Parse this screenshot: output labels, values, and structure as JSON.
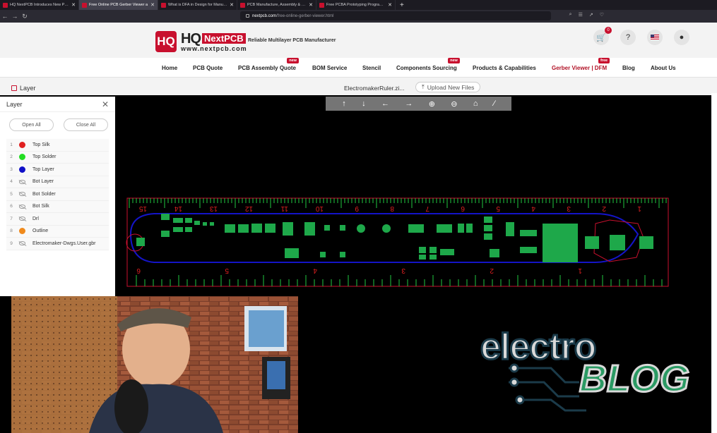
{
  "browser": {
    "tabs": [
      {
        "title": "HQ NextPCB Introduces New PCB Ger",
        "active": false
      },
      {
        "title": "Free Online PCB Gerber Viewer a",
        "active": true
      },
      {
        "title": "What is DFA in Design for Manufactur",
        "active": false
      },
      {
        "title": "PCB Manufacture, Assembly & Protot",
        "active": false
      },
      {
        "title": "Free PCBA Prototyping Program for 1",
        "active": false
      }
    ],
    "new_tab": "+",
    "url_domain": "nextpcb.com",
    "url_path": "/free-online-gerber-viewer.html"
  },
  "site": {
    "logo_mark": "HQ",
    "logo_hq": "HQ",
    "logo_brand": "NextPCB",
    "logo_www": "www.nextpcb.com",
    "tagline": "Reliable Multilayer PCB Manufacturer",
    "cart_count": "0",
    "help_icon": "?",
    "menu": [
      {
        "label": "Home",
        "badge": ""
      },
      {
        "label": "PCB Quote",
        "badge": ""
      },
      {
        "label": "PCB Assembly Quote",
        "badge": "new"
      },
      {
        "label": "BOM Service",
        "badge": ""
      },
      {
        "label": "Stencil",
        "badge": ""
      },
      {
        "label": "Components Sourcing",
        "badge": "new"
      },
      {
        "label": "Products & Capabilities",
        "badge": ""
      },
      {
        "label": "Gerber Viewer | DFM",
        "badge": "free"
      },
      {
        "label": "Blog",
        "badge": ""
      },
      {
        "label": "About Us",
        "badge": ""
      }
    ]
  },
  "viewer": {
    "layer_title": "Layer",
    "file_name": "ElectromakerRuler.zi...",
    "upload_label": "Upload New Files",
    "panel_title": "Layer",
    "open_all": "Open All",
    "close_all": "Close All",
    "layers": [
      {
        "num": "1",
        "name": "Top Silk",
        "color": "#e02020",
        "visible": true
      },
      {
        "num": "2",
        "name": "Top Solder",
        "color": "#22dd22",
        "visible": true
      },
      {
        "num": "3",
        "name": "Top Layer",
        "color": "#1010c8",
        "visible": true
      },
      {
        "num": "4",
        "name": "Bot Layer",
        "color": "",
        "visible": false
      },
      {
        "num": "5",
        "name": "Bot Solder",
        "color": "",
        "visible": false
      },
      {
        "num": "6",
        "name": "Bot Silk",
        "color": "",
        "visible": false
      },
      {
        "num": "7",
        "name": "Drl",
        "color": "",
        "visible": false
      },
      {
        "num": "8",
        "name": "Outline",
        "color": "#f08a1c",
        "visible": true
      },
      {
        "num": "9",
        "name": "Electromaker-Dwgs.User.gbr",
        "color": "",
        "visible": false
      }
    ],
    "tools": [
      "pan-up-icon",
      "pan-down-icon",
      "pan-left-icon",
      "pan-right-icon",
      "zoom-in-icon",
      "zoom-out-icon",
      "fit-home-icon",
      "measure-icon"
    ],
    "ruler_top_numbers": [
      "15",
      "14",
      "13",
      "12",
      "11",
      "10",
      "9",
      "8",
      "7",
      "6",
      "5",
      "4",
      "3",
      "2",
      "1"
    ],
    "ruler_bottom_numbers": [
      "6",
      "5",
      "4",
      "3",
      "2",
      "1"
    ]
  },
  "overlay": {
    "logo_line1": "electro",
    "logo_line2": "BLOG"
  }
}
